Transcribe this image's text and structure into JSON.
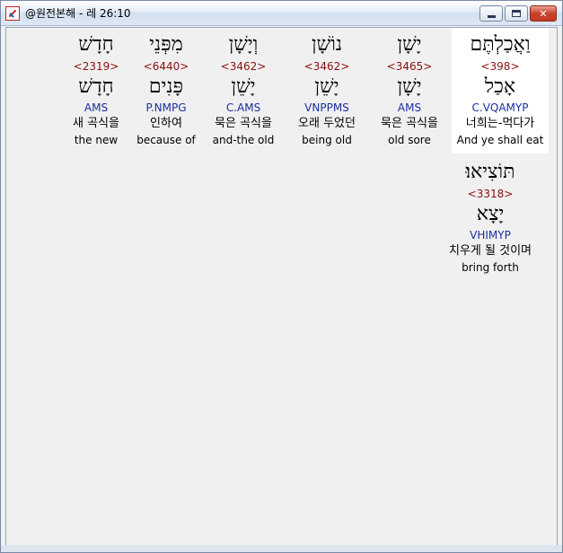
{
  "window": {
    "title": "@원전본해 - 레 26:10",
    "icon": "app-icon",
    "buttons": {
      "minimize": "minimize-icon",
      "maximize": "maximize-icon",
      "close": "close-icon"
    }
  },
  "words": [
    {
      "hebrew": "וַאֲכַלְתֶּם",
      "strong": "<398>",
      "lemma": "אָכַל",
      "parse": "C.VQAMYP",
      "korean": "너희는-먹다가",
      "english": "And ye shall eat",
      "selected": true
    },
    {
      "hebrew": "יָשָׁן",
      "strong": "<3465>",
      "lemma": "יָשָׁן",
      "parse": "AMS",
      "korean": "묵은 곡식을",
      "english": "old sore",
      "selected": false
    },
    {
      "hebrew": "נוֹשָׁן",
      "strong": "<3462>",
      "lemma": "יָשֵׁן",
      "parse": "VNPPMS",
      "korean": "오래 두었던",
      "english": "being old",
      "selected": false
    },
    {
      "hebrew": "וְיָשָׁן",
      "strong": "<3462>",
      "lemma": "יָשֵׁן",
      "parse": "C.AMS",
      "korean": "묵은 곡식을",
      "english": "and-the old",
      "selected": false
    },
    {
      "hebrew": "מִפְּנֵי",
      "strong": "<6440>",
      "lemma": "פָּנִים",
      "parse": "P.NMPG",
      "korean": "인하여",
      "english": "because of",
      "selected": false
    },
    {
      "hebrew": "חָדָשׁ",
      "strong": "<2319>",
      "lemma": "חָדָשׁ",
      "parse": "AMS",
      "korean": "새 곡식을",
      "english": "the new",
      "selected": false
    },
    {
      "hebrew": "תּוֹצִיאוּ׃",
      "strong": "<3318>",
      "lemma": "יָצָא",
      "parse": "VHIMYP",
      "korean": "치우게 될 것이며",
      "english": "bring forth",
      "selected": false
    }
  ],
  "colors": {
    "strong": "#8b1010",
    "parse": "#1a2ea0",
    "selected_bg": "#ffffff",
    "window_bg": "#f0f0f0"
  }
}
